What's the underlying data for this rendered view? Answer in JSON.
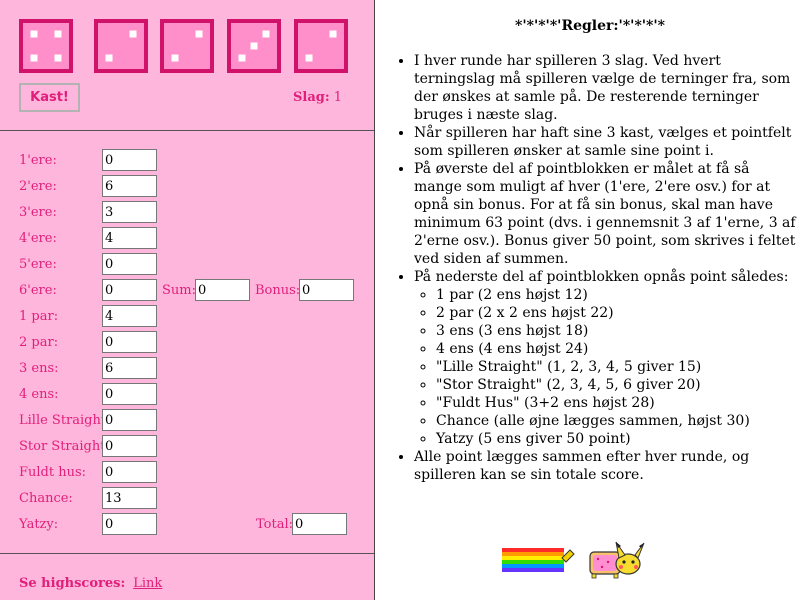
{
  "dice": [
    {
      "value": 4
    },
    {
      "value": 2
    },
    {
      "value": 2
    },
    {
      "value": 3
    },
    {
      "value": 2
    }
  ],
  "colors": {
    "panel": "#ffb6dd",
    "accent": "#e01f7a",
    "die_border": "#d1126a",
    "die_face": "#ff8fcb"
  },
  "controls": {
    "roll_label": "Kast!",
    "slag_label": "Slag:",
    "slag_value": "1"
  },
  "scoreboard": {
    "rows": [
      {
        "label": "1'ere:",
        "value": "0"
      },
      {
        "label": "2'ere:",
        "value": "6"
      },
      {
        "label": "3'ere:",
        "value": "3"
      },
      {
        "label": "4'ere:",
        "value": "4"
      },
      {
        "label": "5'ere:",
        "value": "0"
      },
      {
        "label": "6'ere:",
        "value": "0"
      },
      {
        "label": "1 par:",
        "value": "4"
      },
      {
        "label": "2 par:",
        "value": "0"
      },
      {
        "label": "3 ens:",
        "value": "6"
      },
      {
        "label": "4 ens:",
        "value": "0"
      },
      {
        "label": "Lille Straight:",
        "value": "0"
      },
      {
        "label": "Stor Straight:",
        "value": "0"
      },
      {
        "label": "Fuldt hus:",
        "value": "0"
      },
      {
        "label": "Chance:",
        "value": "13"
      },
      {
        "label": "Yatzy:",
        "value": "0"
      }
    ],
    "sum_label": "Sum:",
    "sum_value": "0",
    "bonus_label": "Bonus:",
    "bonus_value": "0",
    "total_label": "Total:",
    "total_value": "0"
  },
  "highscore": {
    "label": "Se highscores:",
    "link": "Link"
  },
  "rules": {
    "title": "*'*'*'*'Regler:'*'*'*'*",
    "items": [
      "I hver runde har spilleren 3 slag. Ved hvert terningslag må spilleren vælge de terninger fra, som der ønskes at samle på. De resterende terninger bruges i næste slag.",
      "Når spilleren har haft sine 3 kast, vælges et pointfelt som spilleren ønsker at samle sine point i.",
      "På øverste del af pointblokken er målet at få så mange som muligt af hver (1'ere, 2'ere osv.) for at opnå sin bonus. For at få sin bonus, skal man have minimum 63 point (dvs. i gennemsnit 3 af 1'erne, 3 af 2'erne osv.). Bonus giver 50 point, som skrives i feltet ved siden af summen.",
      "På nederste del af pointblokken opnås point således:",
      "Alle point lægges sammen efter hver runde, og spilleren kan se sin totale score."
    ],
    "subitems": [
      "1 par (2 ens højst 12)",
      "2 par (2 x 2 ens højst 22)",
      "3 ens (3 ens højst 18)",
      "4 ens (4 ens højst 24)",
      "\"Lille Straight\" (1, 2, 3, 4, 5 giver 15)",
      "\"Stor Straight\" (2, 3, 4, 5, 6 giver 20)",
      "\"Fuldt Hus\" (3+2 ens højst 28)",
      "Chance (alle øjne lægges sammen, højst 30)",
      "Yatzy (5 ens giver 50 point)"
    ]
  }
}
